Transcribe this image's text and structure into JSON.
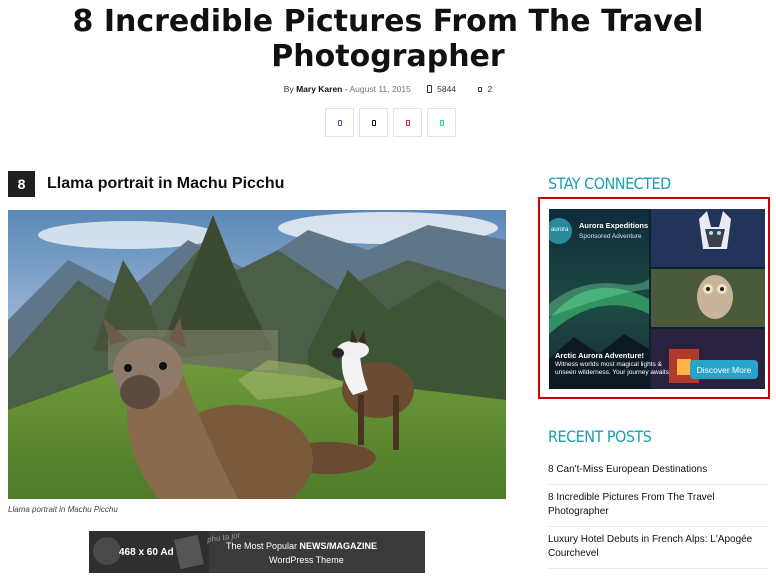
{
  "article": {
    "title": "8 Incredible Pictures From The Travel Photographer",
    "meta": {
      "by": "By",
      "author": "Mary Karen",
      "sep": "-",
      "date": "August 11, 2015",
      "views": "5844",
      "comments": "2"
    },
    "share_icons": [
      "facebook-icon",
      "twitter-icon",
      "pinterest-icon",
      "whatsapp-icon"
    ],
    "step": {
      "number": "8",
      "heading": "Llama portrait in Machu Picchu"
    },
    "caption": "Llama portrait in Machu Picchu",
    "banner_ad": {
      "size": "468 x 60 Ad",
      "brand": "phu ta jor",
      "line1_a": "The Most Popular ",
      "line1_b": "NEWS/MAGAZINE",
      "line2": "WordPress Theme"
    }
  },
  "sidebar": {
    "stay_connected": "STAY CONNECTED",
    "sponsored_ad": {
      "logo": "aurora",
      "advertiser": "Aurora Expeditions",
      "label": "Sponsored Adventure",
      "headline": "Arctic Aurora Adventure!",
      "body": "Witness worlds most magical lights & unseen wilderness. Your journey awaits",
      "cta": "Discover More"
    },
    "recent_posts_title": "RECENT POSTS",
    "recent_posts": [
      "8 Can't-Miss European Destinations",
      "8 Incredible Pictures From The Travel Photographer",
      "Luxury Hotel Debuts in French Alps: L'Apogée Courchevel"
    ]
  },
  "colors": {
    "accent": "#1aa0b0",
    "ad_border": "#d20000",
    "cta": "#2aa3c8"
  }
}
